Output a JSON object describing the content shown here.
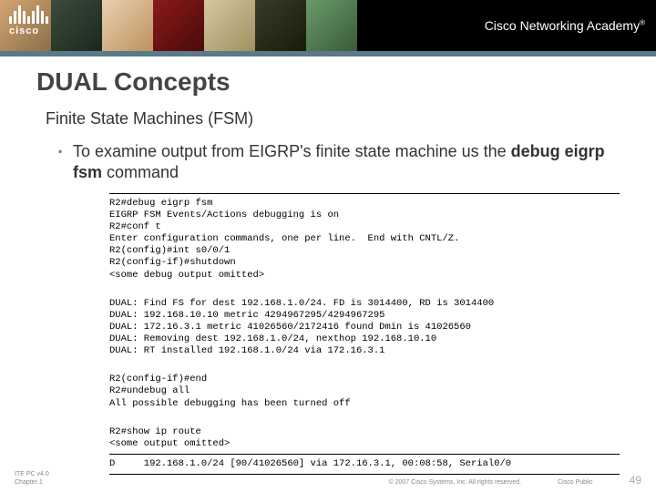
{
  "header": {
    "logo_text": "cisco",
    "academy_text": "Cisco Networking Academy",
    "academy_mark": "®"
  },
  "slide": {
    "title": "DUAL Concepts",
    "subtitle": "Finite State Machines (FSM)",
    "bullet_text": "To examine output from EIGRP's finite state machine us the ",
    "bullet_bold": "debug eigrp fsm",
    "bullet_tail": " command"
  },
  "terminal": {
    "block1": "R2#debug eigrp fsm\nEIGRP FSM Events/Actions debugging is on\nR2#conf t\nEnter configuration commands, one per line.  End with CNTL/Z.\nR2(config)#int s0/0/1\nR2(config-if)#shutdown\n<some debug output omitted>",
    "block2": "DUAL: Find FS for dest 192.168.1.0/24. FD is 3014400, RD is 3014400\nDUAL: 192.168.10.10 metric 4294967295/4294967295\nDUAL: 172.16.3.1 metric 41026560/2172416 found Dmin is 41026560\nDUAL: Removing dest 192.168.1.0/24, nexthop 192.168.10.10\nDUAL: RT installed 192.168.1.0/24 via 172.16.3.1",
    "block3": "R2(config-if)#end\nR2#undebug all\nAll possible debugging has been turned off",
    "block4": "R2#show ip route\n<some output omitted>",
    "block5": "D     192.168.1.0/24 [90/41026560] via 172.16.3.1, 00:08:58, Serial0/0"
  },
  "footer": {
    "left_line1": "ITE PC v4.0",
    "left_line2": "Chapter 1",
    "copyright": "© 2007 Cisco Systems, Inc. All rights reserved.",
    "classification": "Cisco Public",
    "page": "49"
  }
}
